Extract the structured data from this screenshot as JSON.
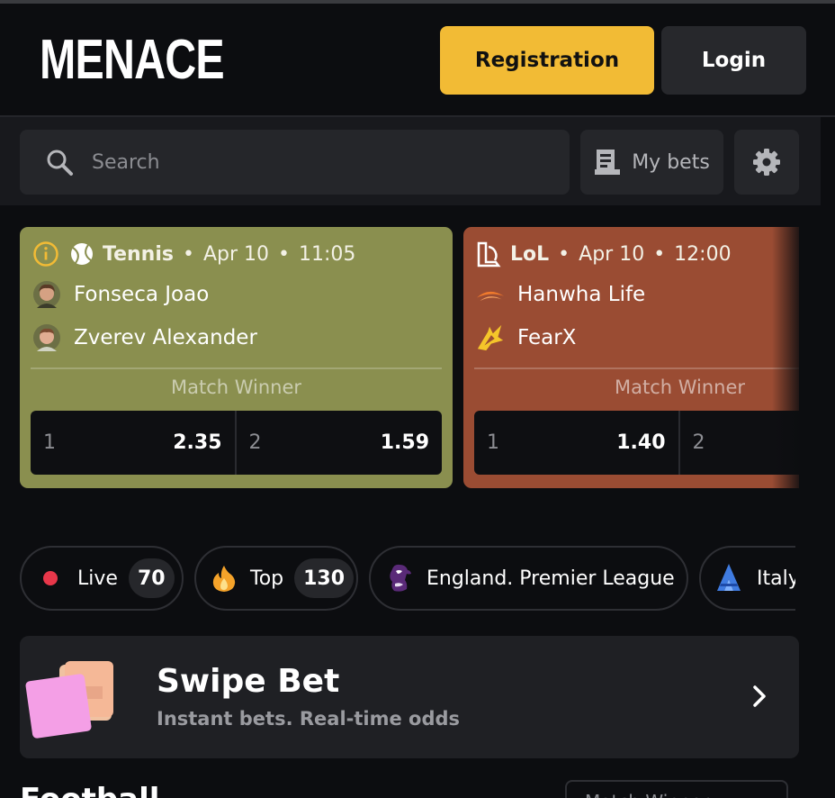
{
  "header": {
    "logo": "MENACE",
    "registration_label": "Registration",
    "login_label": "Login"
  },
  "search": {
    "placeholder": "Search",
    "mybets_label": "My bets",
    "icons": [
      "search-icon",
      "receipt-icon",
      "gear-icon"
    ]
  },
  "matches": [
    {
      "sport": "Tennis",
      "date": "Apr 10",
      "time": "11:05",
      "team1": "Fonseca Joao",
      "team2": "Zverev Alexander",
      "market": "Match Winner",
      "odds": [
        {
          "label": "1",
          "value": "2.35"
        },
        {
          "label": "2",
          "value": "1.59"
        }
      ],
      "color": "#8a8f4f"
    },
    {
      "sport": "LoL",
      "date": "Apr 10",
      "time": "12:00",
      "team1": "Hanwha Life",
      "team2": "FearX",
      "market": "Match Winner",
      "odds": [
        {
          "label": "1",
          "value": "1.40"
        },
        {
          "label": "2",
          "value": ""
        }
      ],
      "color": "#9a4c33"
    }
  ],
  "chips": [
    {
      "label": "Live",
      "count": "70",
      "icon": "live-dot-icon"
    },
    {
      "label": "Top",
      "count": "130",
      "icon": "fire-icon"
    },
    {
      "label": "England. Premier League",
      "count": "",
      "icon": "premier-league-icon"
    },
    {
      "label": "Italy",
      "count": "",
      "icon": "serie-a-icon"
    }
  ],
  "swipe": {
    "title": "Swipe Bet",
    "subtitle": "Instant bets. Real-time odds"
  },
  "section": {
    "title": "Football",
    "market_select": "Match Winner"
  },
  "colors": {
    "accent": "#f2bb35",
    "background": "#0c0d10",
    "live": "#e8374a"
  }
}
